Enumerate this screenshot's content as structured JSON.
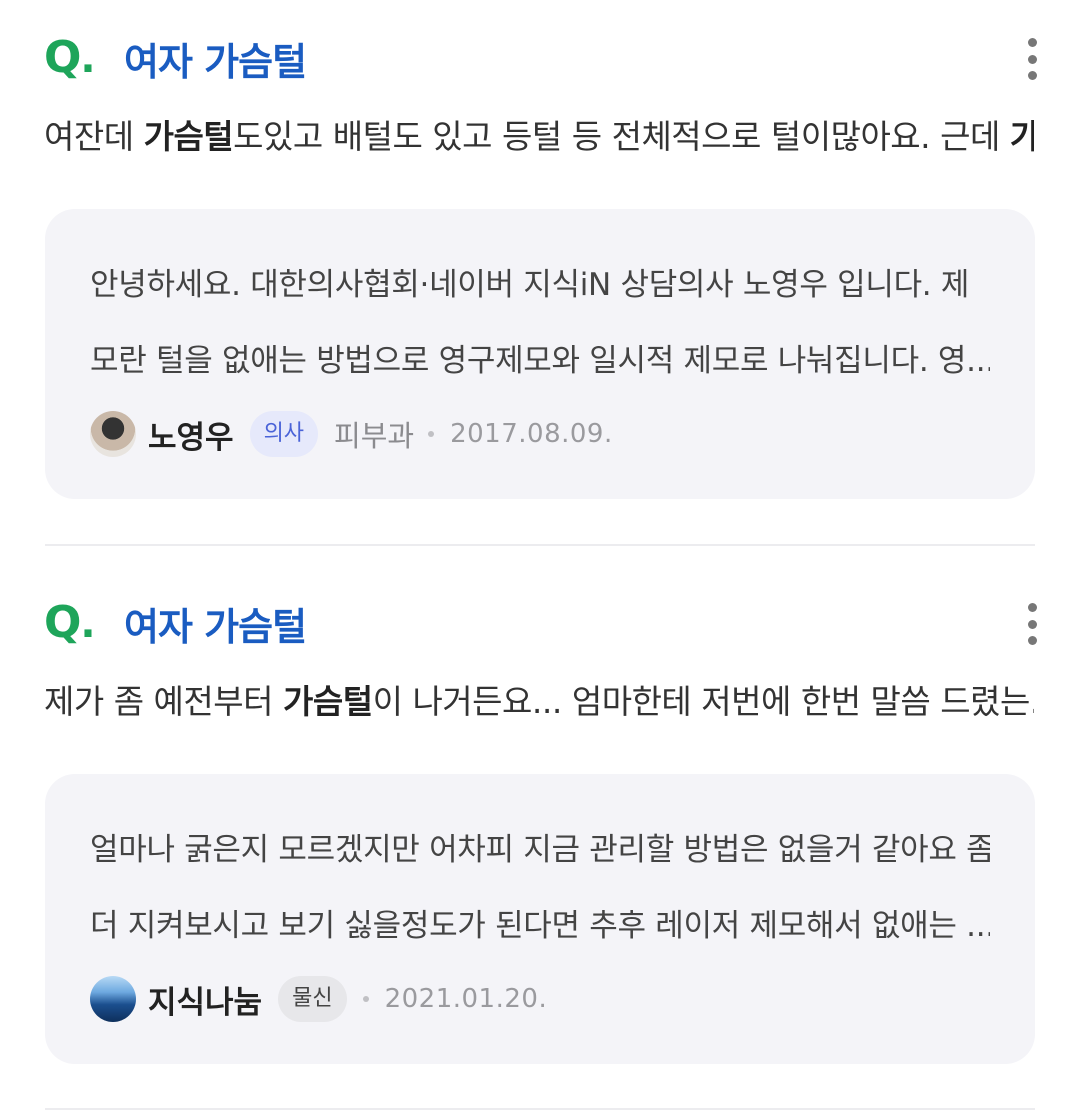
{
  "items": [
    {
      "q_mark": "Q",
      "q_dot": ".",
      "title": "여자 가슴털",
      "excerpt_pre": "여잔데 ",
      "excerpt_bold1": "가슴털",
      "excerpt_mid": "도있고 배털도 있고 등털 등 전체적으로 털이많아요. 근데 ",
      "excerpt_bold2": "가슴...",
      "answer_line1": "안녕하세요. 대한의사협회·네이버 지식iN 상담의사 노영우 입니다. 제",
      "answer_line2": "모란 털을 없애는 방법으로 영구제모와 일시적 제모로 나눠집니다. 영...",
      "author": "노영우",
      "role": "의사",
      "department": "피부과",
      "date": "2017.08.09."
    },
    {
      "q_mark": "Q",
      "q_dot": ".",
      "title": "여자 가슴털",
      "excerpt_pre": "제가 좀 예전부터 ",
      "excerpt_bold1": "가슴털",
      "excerpt_mid": "이 나거든요... 엄마한테 저번에 한번 말씀 드렸는...",
      "excerpt_bold2": "",
      "answer_line1": "얼마나 굵은지 모르겠지만 어차피 지금 관리할 방법은 없을거 같아요 좀",
      "answer_line2": "더 지켜보시고 보기 싫을정도가 된다면 추후 레이저 제모해서 없애는 ...",
      "author": "지식나눔",
      "role": "물신",
      "department": "",
      "date": "2021.01.20."
    }
  ],
  "colors": {
    "q_mark": "#1ea55a",
    "title": "#1a5cc1",
    "card_bg": "#f4f4f8",
    "doctor_badge_bg": "#e6e9fb",
    "doctor_badge_text": "#4a63d8"
  },
  "icons": {
    "more": "more-vertical-icon"
  }
}
